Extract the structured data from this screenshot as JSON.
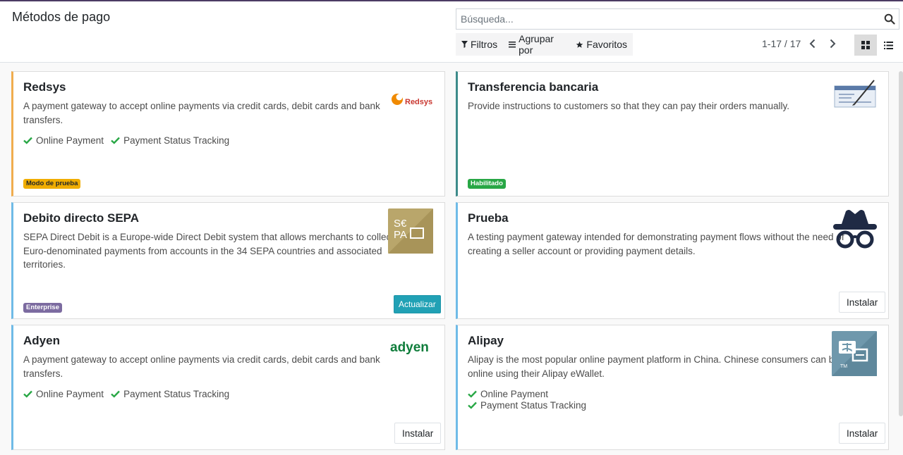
{
  "header": {
    "title": "Métodos de pago",
    "search_placeholder": "Búsqueda...",
    "filters": "Filtros",
    "group_by": "Agrupar por",
    "favorites": "Favoritos",
    "pager": "1-17 / 17"
  },
  "cards": [
    {
      "title": "Redsys",
      "desc": [
        "A payment gateway to accept online payments via credit cards, debit cards and bank",
        "transfers."
      ],
      "features": [
        "Online Payment",
        "Payment Status Tracking"
      ],
      "badge": "Modo de prueba",
      "logo_text": "Redsys",
      "accent": "#f0ad4e"
    },
    {
      "title": "Transferencia bancaria",
      "desc": [
        "Provide instructions to customers so that they can pay their orders manually."
      ],
      "badge": "Habilitado",
      "accent": "#3d8b8a"
    },
    {
      "title": "Debito directo SEPA",
      "desc": [
        "SEPA Direct Debit is a Europe-wide Direct Debit system that allows merchants to collect",
        "Euro-denominated payments from accounts in the 34 SEPA countries and associated",
        "territories."
      ],
      "badge": "Enterprise",
      "button": "Actualizar",
      "logo_text_top": "S€",
      "logo_text_bottom": "PA",
      "accent": "#6fbbe7"
    },
    {
      "title": "Prueba",
      "desc": [
        "A testing payment gateway intended for demonstrating payment flows without the need of",
        "creating a seller account or providing payment details."
      ],
      "button": "Instalar",
      "accent": "#6fbbe7"
    },
    {
      "title": "Adyen",
      "desc": [
        "A payment gateway to accept online payments via credit cards, debit cards and bank",
        "transfers."
      ],
      "features": [
        "Online Payment",
        "Payment Status Tracking"
      ],
      "button": "Instalar",
      "logo_text": "adyen",
      "accent": "#6fbbe7"
    },
    {
      "title": "Alipay",
      "desc": [
        "Alipay is the most popular online payment platform in China. Chinese consumers can buy",
        "online using their Alipay eWallet."
      ],
      "features": [
        "Online Payment",
        "Payment Status Tracking"
      ],
      "button": "Instalar",
      "logo_text": "TM",
      "accent": "#6fbbe7"
    }
  ],
  "colors": {
    "check": "#28a745",
    "badge_test_bg": "#f0ad00",
    "badge_enabled_bg": "#28a745",
    "badge_enterprise_bg": "#7c6ba0"
  }
}
